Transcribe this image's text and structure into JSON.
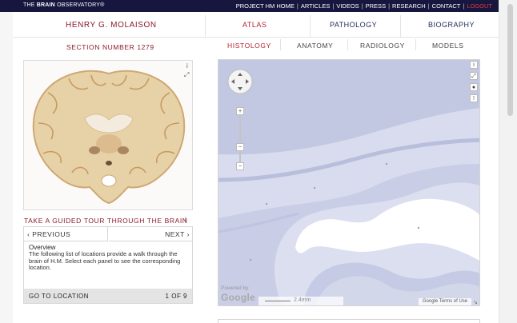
{
  "topbar": {
    "logo_prefix": "THE ",
    "logo_bold": "BRAIN",
    "logo_suffix": " OBSERVATORY®",
    "nav": [
      "PROJECT HM HOME",
      "ARTICLES",
      "VIDEOS",
      "PRESS",
      "RESEARCH",
      "CONTACT"
    ],
    "logout": "LOGOUT"
  },
  "header": {
    "name": "HENRY G. MOLAISON",
    "tabs": [
      {
        "label": "ATLAS",
        "active": true
      },
      {
        "label": "PATHOLOGY",
        "active": false
      },
      {
        "label": "BIOGRAPHY",
        "active": false
      }
    ]
  },
  "section": {
    "label": "SECTION NUMBER 1279"
  },
  "subtabs": [
    {
      "label": "HISTOLOGY",
      "active": true
    },
    {
      "label": "ANATOMY",
      "active": false
    },
    {
      "label": "RADIOLOGY",
      "active": false
    },
    {
      "label": "MODELS",
      "active": false
    }
  ],
  "thumbnail": {
    "info_icon": "i",
    "expand_icon": "⤢"
  },
  "tour": {
    "title": "TAKE A GUIDED TOUR THROUGH THE BRAIN",
    "info_icon": "i",
    "prev_label": "PREVIOUS",
    "next_label": "NEXT",
    "overview_title": "Overview",
    "overview_text": "The following list of locations provide a walk through the brain of H.M. Select each panel to see the corresponding location.",
    "goto_label": "GO TO LOCATION",
    "count": "1 OF 9"
  },
  "map": {
    "zoom_in": "+",
    "zoom_out": "−",
    "powered_by": "Powered by",
    "google": "Google",
    "scale": "2.4mm",
    "terms": "Google Terms of Use",
    "side_icons": [
      "i",
      "⤢",
      "●",
      "!"
    ]
  },
  "colors": {
    "topbar": "#16163f",
    "accent": "#8b1a2b",
    "active_tab": "#b52232",
    "tissue": "#c4c9e3"
  }
}
